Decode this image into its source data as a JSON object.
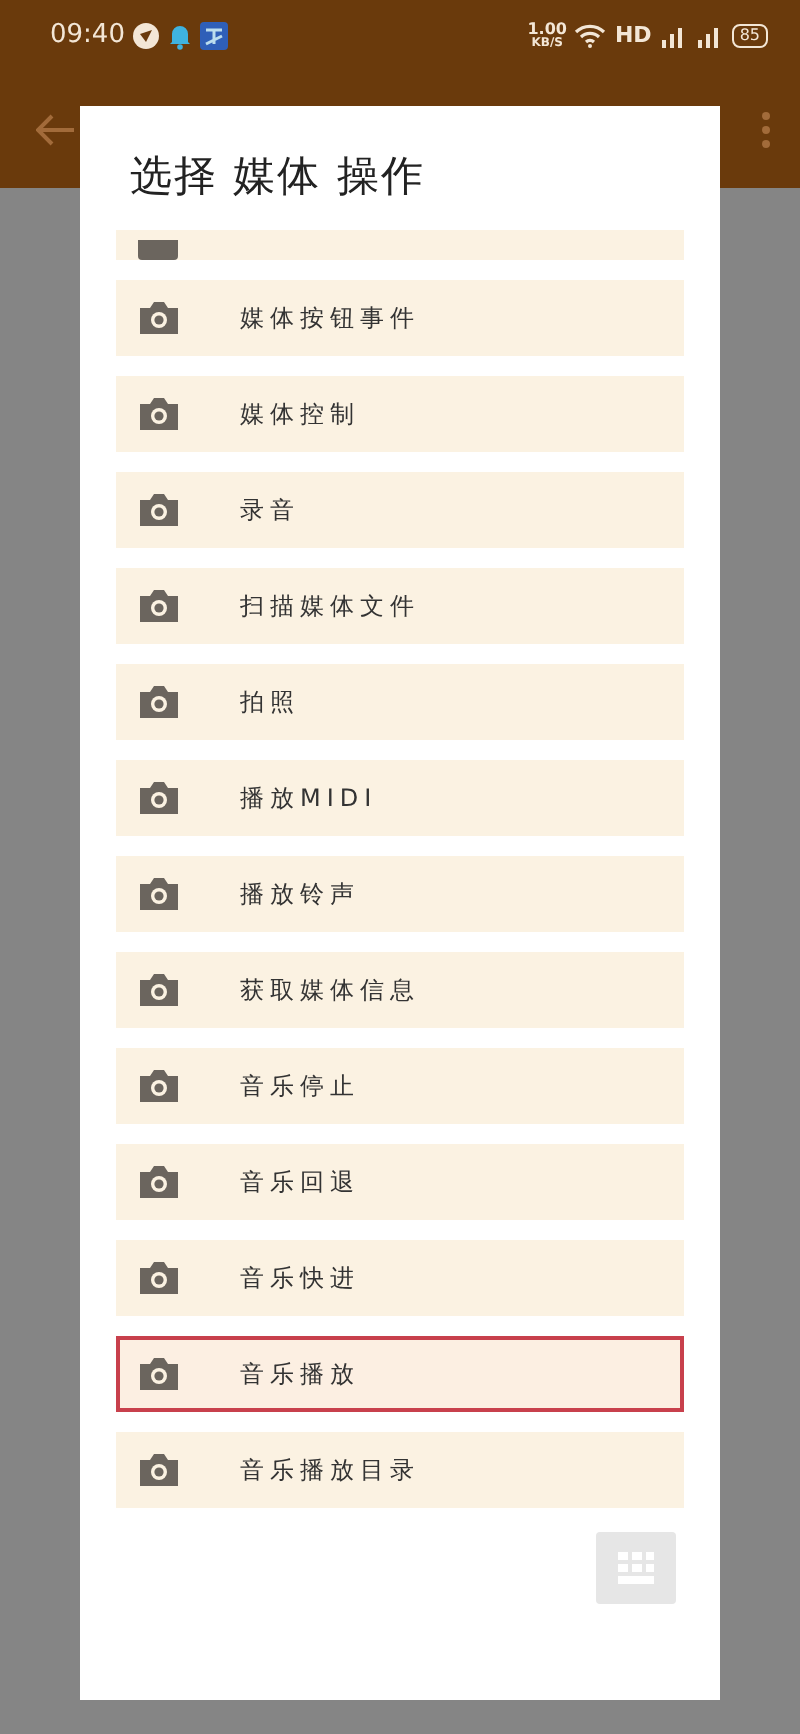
{
  "status_bar": {
    "time": "09:40",
    "net_speed": "1.00",
    "net_unit": "KB/S",
    "network": "HD",
    "battery": "85"
  },
  "dialog": {
    "title": "选择 媒体 操作",
    "items": [
      {
        "label": "媒体按钮事件",
        "selected": false
      },
      {
        "label": "媒体控制",
        "selected": false
      },
      {
        "label": "录音",
        "selected": false
      },
      {
        "label": "扫描媒体文件",
        "selected": false
      },
      {
        "label": "拍照",
        "selected": false
      },
      {
        "label": "播放MIDI",
        "selected": false
      },
      {
        "label": "播放铃声",
        "selected": false
      },
      {
        "label": "获取媒体信息",
        "selected": false
      },
      {
        "label": "音乐停止",
        "selected": false
      },
      {
        "label": "音乐回退",
        "selected": false
      },
      {
        "label": "音乐快进",
        "selected": false
      },
      {
        "label": "音乐播放",
        "selected": true
      },
      {
        "label": "音乐播放目录",
        "selected": false
      }
    ]
  }
}
